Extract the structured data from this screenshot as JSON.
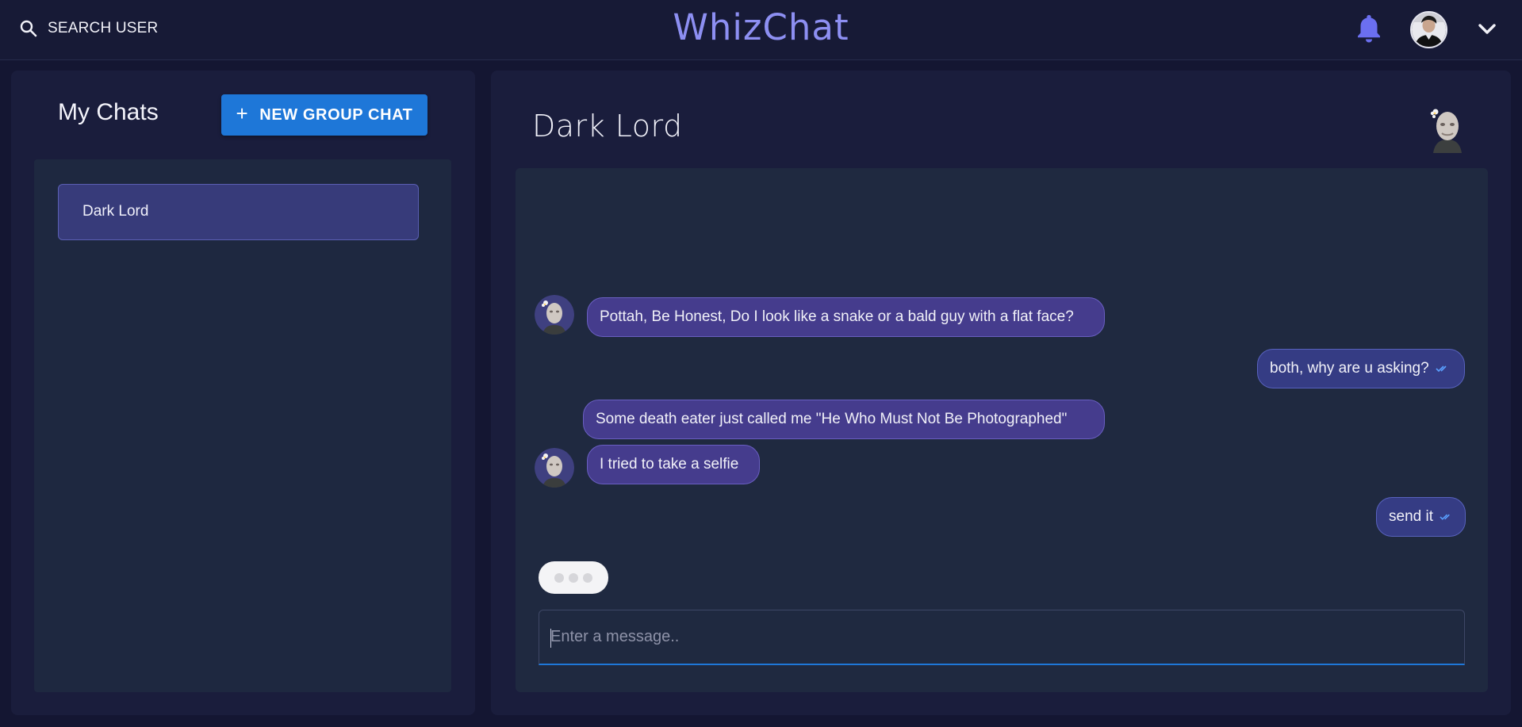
{
  "header": {
    "search_label": "SEARCH USER",
    "brand": "WhizChat",
    "icons": [
      "search-icon",
      "bell-icon",
      "user-avatar",
      "chevron-down-icon"
    ],
    "accent_color": "#8d8ff2"
  },
  "sidebar": {
    "title": "My Chats",
    "new_group_label": "NEW GROUP CHAT",
    "chats": [
      {
        "name": "Dark Lord",
        "selected": true
      }
    ]
  },
  "chat": {
    "title": "Dark Lord",
    "messages": [
      {
        "from": "Dark Lord",
        "direction": "in",
        "text": "Pottah, Be Honest, Do I look like a snake or a bald guy with a flat face?"
      },
      {
        "from": "me",
        "direction": "out",
        "text": "both, why are u asking?",
        "status": "read"
      },
      {
        "from": "Dark Lord",
        "direction": "in",
        "text": "Some death eater just called me \"He Who Must Not Be Photographed\""
      },
      {
        "from": "Dark Lord",
        "direction": "in",
        "text": "I tried to take a selfie"
      },
      {
        "from": "me",
        "direction": "out",
        "text": "send it",
        "status": "read"
      }
    ],
    "typing_indicator": true,
    "input": {
      "placeholder": "Enter a message..",
      "value": ""
    }
  },
  "colors": {
    "background": "#141632",
    "button_blue": "#1e77d8",
    "incoming_bubble": "#453c8d",
    "outgoing_bubble": "#353c84"
  }
}
